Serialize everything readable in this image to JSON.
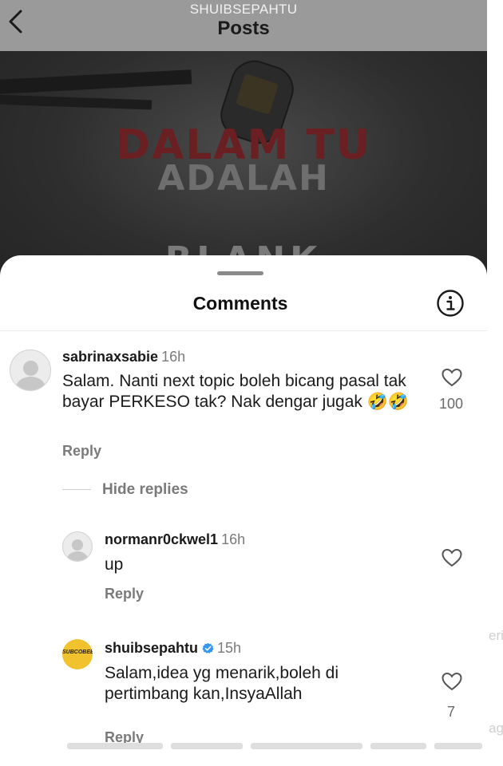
{
  "header": {
    "account": "SHUIBSEPAHTU",
    "title": "Posts"
  },
  "post": {
    "overlay_line1": "DALAM TU",
    "overlay_line2": "ADALAH",
    "overlay_line3": "BLANK"
  },
  "edge": {
    "text1": "eri",
    "text2": "ag"
  },
  "sheet": {
    "title": "Comments"
  },
  "comments": [
    {
      "username": "sabrinaxsabie",
      "time": "16h",
      "text": "Salam. Nanti next topic boleh bicang pasal tak bayar PERKESO tak?  Nak dengar jugak 🤣🤣",
      "reply_label": "Reply",
      "likes": "100"
    }
  ],
  "replies_toggle": "Hide replies",
  "replies": [
    {
      "username": "normanr0ckwel1",
      "time": "16h",
      "text": "up",
      "reply_label": "Reply",
      "likes": ""
    },
    {
      "username": "shuibsepahtu",
      "verified": true,
      "time": "15h",
      "text": "Salam,idea yg menarik,boleh di pertimbang kan,InsyaAllah",
      "reply_label": "Reply",
      "likes": "7",
      "avatar_text": "SUBCOBEE"
    }
  ],
  "colors": {
    "verified": "#3797f0",
    "brand_avatar": "#f2c12e",
    "header_bg": "#9a9a9a"
  }
}
